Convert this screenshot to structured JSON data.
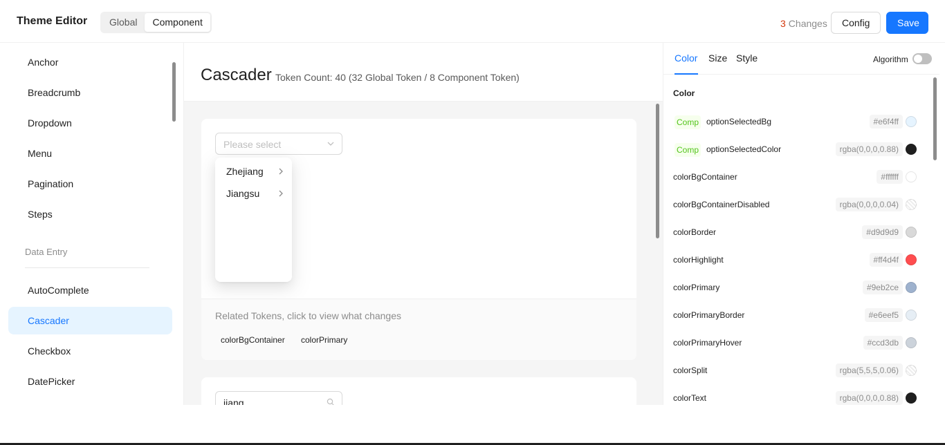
{
  "header": {
    "title": "Theme Editor",
    "segments": [
      "Global",
      "Component"
    ],
    "active_segment": "Component",
    "changes_count": "3",
    "changes_label": "Changes",
    "config_label": "Config",
    "save_label": "Save"
  },
  "sidebar": {
    "items_top": [
      "Anchor",
      "Breadcrumb",
      "Dropdown",
      "Menu",
      "Pagination",
      "Steps"
    ],
    "group_label": "Data Entry",
    "items_bottom": [
      "AutoComplete",
      "Cascader",
      "Checkbox",
      "DatePicker"
    ],
    "selected": "Cascader"
  },
  "main": {
    "component_title": "Cascader",
    "token_count": "Token Count: 40 (32 Global Token / 8 Component Token)",
    "demo1": {
      "placeholder": "Please select",
      "options": [
        "Zhejiang",
        "Jiangsu"
      ]
    },
    "related_label": "Related Tokens, click to view what changes",
    "related_tokens": [
      "colorBgContainer",
      "colorPrimary"
    ],
    "demo2": {
      "search_value": "jiang"
    }
  },
  "panel": {
    "tabs": [
      "Color",
      "Size",
      "Style"
    ],
    "active_tab": "Color",
    "algorithm_label": "Algorithm",
    "algorithm_on": false,
    "section_title": "Color",
    "comp_tag_label": "Comp",
    "tokens": [
      {
        "name": "optionSelectedBg",
        "value": "#e6f4ff",
        "comp": true,
        "swatch": "#e6f4ff"
      },
      {
        "name": "optionSelectedColor",
        "value": "rgba(0,0,0,0.88)",
        "comp": true,
        "swatch": "#1f1f1f"
      },
      {
        "name": "colorBgContainer",
        "value": "#ffffff",
        "comp": false,
        "swatch": "#ffffff"
      },
      {
        "name": "colorBgContainerDisabled",
        "value": "rgba(0,0,0,0.04)",
        "comp": false,
        "swatch": "transparent-check"
      },
      {
        "name": "colorBorder",
        "value": "#d9d9d9",
        "comp": false,
        "swatch": "#d9d9d9"
      },
      {
        "name": "colorHighlight",
        "value": "#ff4d4f",
        "comp": false,
        "swatch": "#ff4d4f"
      },
      {
        "name": "colorPrimary",
        "value": "#9eb2ce",
        "comp": false,
        "swatch": "#9eb2ce"
      },
      {
        "name": "colorPrimaryBorder",
        "value": "#e6eef5",
        "comp": false,
        "swatch": "#e6eef5"
      },
      {
        "name": "colorPrimaryHover",
        "value": "#ccd3db",
        "comp": false,
        "swatch": "#ccd3db"
      },
      {
        "name": "colorSplit",
        "value": "rgba(5,5,5,0.06)",
        "comp": false,
        "swatch": "transparent-check"
      },
      {
        "name": "colorText",
        "value": "rgba(0,0,0,0.88)",
        "comp": false,
        "swatch": "#1f1f1f"
      }
    ]
  },
  "colors": {
    "accent": "#1677ff",
    "selected_bg": "#e6f4ff",
    "changes_count": "#d4380d",
    "comp_tag": "#52c41a"
  }
}
